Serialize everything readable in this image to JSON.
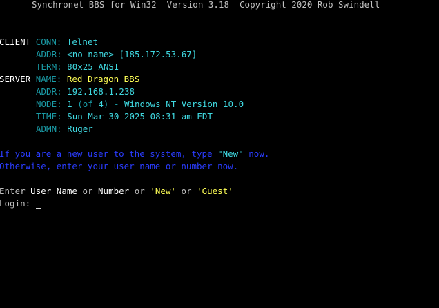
{
  "header": {
    "title": "Synchronet BBS for Win32  Version 3.18  Copyright 2020 Rob Swindell"
  },
  "client": {
    "section_label": "CLIENT",
    "conn_label": "CONN:",
    "conn_value": "Telnet",
    "addr_label": "ADDR:",
    "addr_value": "<no name> [185.172.53.67]",
    "term_label": "TERM:",
    "term_value": "80x25 ANSI"
  },
  "server": {
    "section_label": "SERVER",
    "name_label": "NAME:",
    "name_value": "Red Dragon BBS",
    "addr_label": "ADDR:",
    "addr_value": "192.168.1.238",
    "node_label": "NODE:",
    "node_num": "1",
    "node_of_open": "(of",
    "node_total": "4",
    "node_of_close": ")",
    "node_sep": "-",
    "node_os": "Windows NT Version 10.0",
    "time_label": "TIME:",
    "time_value": "Sun Mar 30 2025 08:31 am EDT",
    "admin_label": "ADMN:",
    "admin_value": "Ruger"
  },
  "instructions": {
    "line1_prefix": "If you are a new user to the system, type",
    "line1_keyword": "\"New\"",
    "line1_suffix": "now.",
    "line2": "Otherwise, enter your user name or number now."
  },
  "prompt": {
    "enter": "Enter",
    "user_name": "User Name",
    "or1": "or",
    "number": "Number",
    "or2": "or",
    "new_opt": "'New'",
    "or3": "or",
    "guest_opt": "'Guest'",
    "login_label": "Login:"
  },
  "colors": {
    "background": "#000000",
    "label_cyan": "#1a9ba6",
    "value_cyan": "#3fd8e0",
    "highlight_yellow": "#ffff55",
    "info_blue": "#2a3cff",
    "text_white": "#ffffff",
    "text_gray": "#c0c0c0"
  }
}
